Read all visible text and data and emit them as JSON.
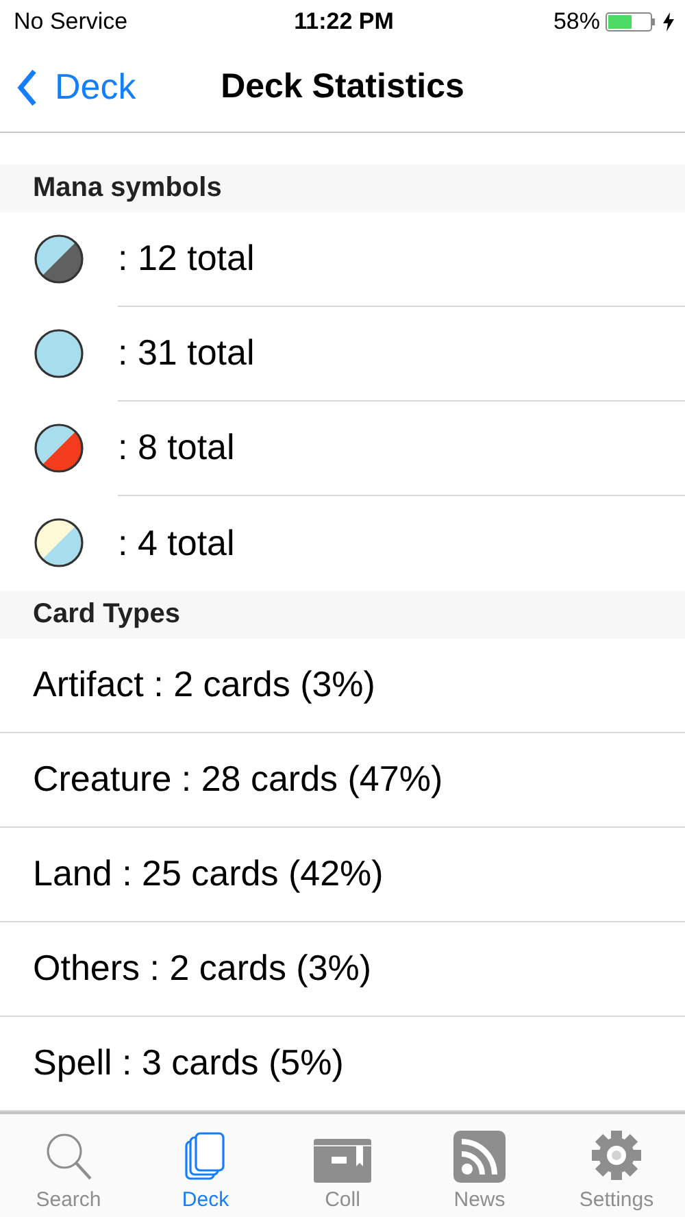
{
  "status_bar": {
    "carrier": "No Service",
    "time": "11:22 PM",
    "battery": "58%"
  },
  "nav": {
    "back": "Deck",
    "title": "Deck Statistics"
  },
  "mana_section": {
    "title": "Mana symbols",
    "symbols": [
      {
        "halves": [
          {
            "color": "#a8ddee"
          },
          {
            "color": "#606060"
          }
        ],
        "text": ": 12 total"
      },
      {
        "halves": [
          {
            "color": "#a8ddee"
          }
        ],
        "text": ": 31 total"
      },
      {
        "halves": [
          {
            "color": "#a8ddee"
          },
          {
            "color": "#f23c1c"
          }
        ],
        "text": ": 8 total"
      },
      {
        "halves": [
          {
            "color": "#fdf9d6"
          },
          {
            "color": "#a8ddee"
          }
        ],
        "text": ": 4 total"
      }
    ]
  },
  "types_section": {
    "title": "Card Types",
    "rows": [
      "Artifact : 2 cards (3%)",
      "Creature : 28 cards (47%)",
      "Land : 25 cards (42%)",
      "Others : 2 cards (3%)",
      "Spell : 3 cards (5%)"
    ]
  },
  "tab_bar": [
    {
      "kind": "search",
      "label": "Search",
      "selected": false
    },
    {
      "kind": "deck",
      "label": "Deck",
      "selected": true
    },
    {
      "kind": "collection",
      "label": "Coll",
      "selected": false
    },
    {
      "kind": "news",
      "label": "News",
      "selected": false
    },
    {
      "kind": "settings",
      "label": "Settings",
      "selected": false
    }
  ]
}
